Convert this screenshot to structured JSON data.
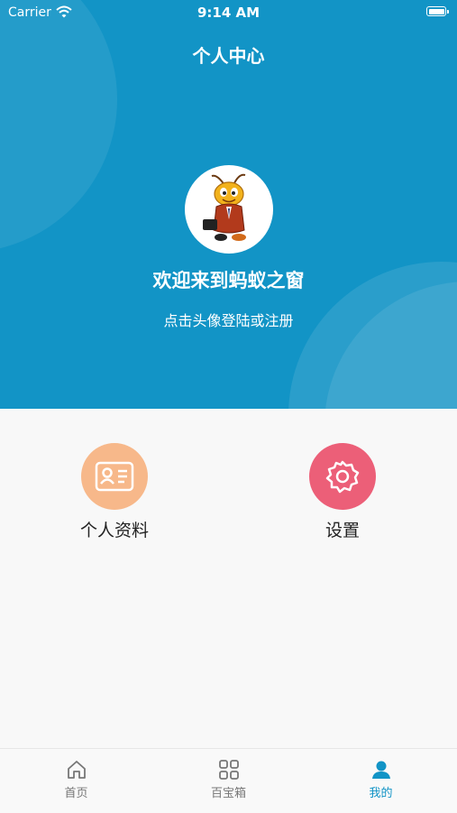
{
  "status": {
    "carrier": "Carrier",
    "time": "9:14 AM"
  },
  "nav": {
    "title": "个人中心"
  },
  "profile": {
    "welcome": "欢迎来到蚂蚁之窗",
    "hint": "点击头像登陆或注册"
  },
  "menu": [
    {
      "label": "个人资料",
      "icon": "profile-card-icon",
      "color": "#f7b88a"
    },
    {
      "label": "设置",
      "icon": "gear-icon",
      "color": "#ec5f78"
    }
  ],
  "tabs": [
    {
      "label": "首页",
      "icon": "home-icon"
    },
    {
      "label": "百宝箱",
      "icon": "grid-icon"
    },
    {
      "label": "我的",
      "icon": "user-icon",
      "active": true
    }
  ],
  "colors": {
    "primary": "#1294c6",
    "tab_active": "#1294c6"
  }
}
